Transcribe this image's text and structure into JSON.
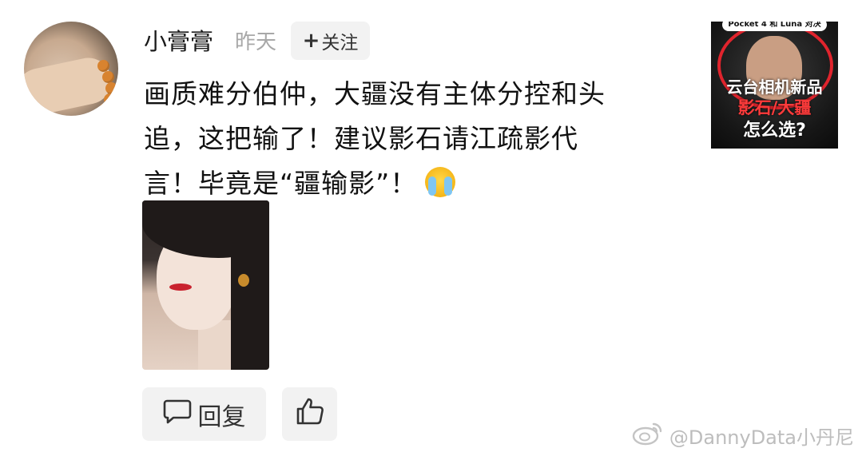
{
  "post": {
    "username": "小膏膏",
    "time": "昨天",
    "follow_label": "关注",
    "comment_lines": [
      "画质难分伯仲，大疆没有主体分控和头",
      "追，这把输了！建议影石请江疏影代",
      "言！毕竟是“疆输影”！"
    ],
    "emoji": "cry-laugh-emoji"
  },
  "thumbnail": {
    "top_text": "Pocket 4 和 Luna 对决",
    "title_line1": "云台相机新品",
    "title_line2": "影石/大疆",
    "title_line3": "怎么选?"
  },
  "actions": {
    "reply_label": "回复",
    "reply_icon": "comment-bubble-icon",
    "like_icon": "thumbs-up-icon"
  },
  "watermark": {
    "text": "@DannyData小丹尼",
    "logo": "weibo-logo-icon"
  },
  "colors": {
    "text": "#1a1a1a",
    "muted": "#a8a8a8",
    "button_bg": "#f2f2f2",
    "accent_red": "#e0242d"
  }
}
